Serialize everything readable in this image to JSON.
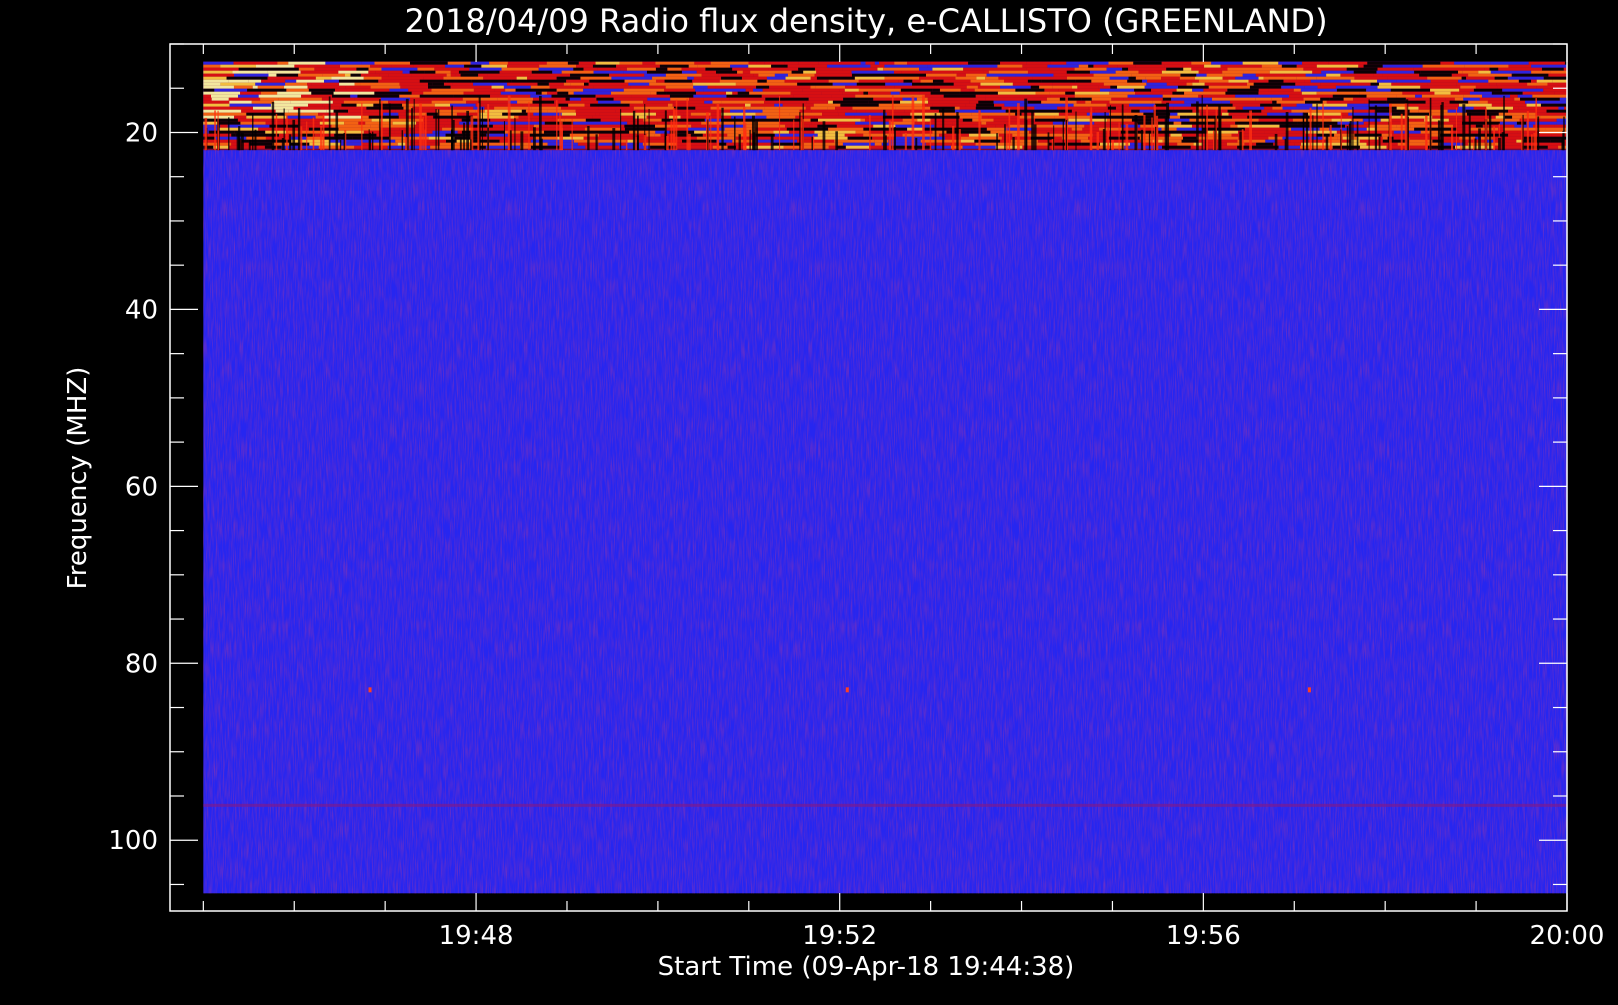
{
  "chart_data": {
    "type": "heatmap",
    "title": "2018/04/09  Radio flux density, e-CALLISTO (GREENLAND)",
    "xlabel": "Start Time (09-Apr-18 19:44:38)",
    "ylabel": "Frequency (MHZ)",
    "x_axis": {
      "unit": "time",
      "range": [
        "19:44:38",
        "20:00:00"
      ],
      "data_range": [
        "19:45:00",
        "20:00:00"
      ],
      "major_ticks": [
        "19:48",
        "19:52",
        "19:56",
        "20:00"
      ],
      "minor_tick_interval_min": 1
    },
    "y_axis": {
      "unit": "MHz",
      "range": [
        10,
        108
      ],
      "data_range": [
        12,
        106
      ],
      "inverted": true,
      "major_ticks": [
        20,
        40,
        60,
        80,
        100
      ],
      "minor_tick_interval": 5
    },
    "colorscale": {
      "background": "#2626f0",
      "low": "#000000",
      "mid": "#e01010",
      "high": "#ffd040",
      "peak": "#ffffaa"
    },
    "features": [
      {
        "kind": "interference_band",
        "freq_range": [
          12,
          22
        ],
        "time_range": [
          "19:45:00",
          "20:00:00"
        ],
        "intensity": "high"
      },
      {
        "kind": "noise_line",
        "freq": 96,
        "time_range": [
          "19:45:00",
          "20:00:00"
        ],
        "intensity": "low"
      },
      {
        "kind": "spot",
        "freq": 83,
        "time": "19:46:50",
        "intensity": "mid"
      },
      {
        "kind": "spot",
        "freq": 83,
        "time": "19:52:05",
        "intensity": "mid"
      },
      {
        "kind": "spot",
        "freq": 83,
        "time": "19:57:10",
        "intensity": "mid"
      }
    ],
    "grid": false,
    "legend": "none"
  }
}
